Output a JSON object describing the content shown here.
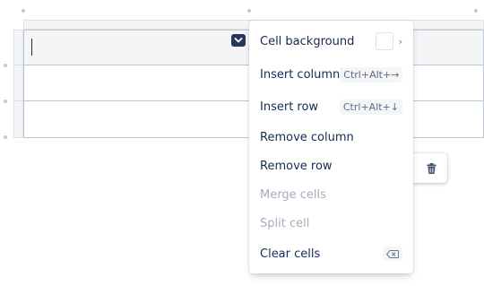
{
  "context_menu": {
    "items": [
      {
        "label": "Cell background",
        "disabled": false
      },
      {
        "label": "Insert column",
        "shortcut": "Ctrl+Alt+→",
        "disabled": false
      },
      {
        "label": "Insert row",
        "shortcut": "Ctrl+Alt+↓",
        "disabled": false
      },
      {
        "label": "Remove column",
        "disabled": false
      },
      {
        "label": "Remove row",
        "disabled": false
      },
      {
        "label": "Merge cells",
        "disabled": true
      },
      {
        "label": "Split cell",
        "disabled": true
      },
      {
        "label": "Clear cells",
        "disabled": false
      }
    ],
    "cell_background_chevron": "›"
  },
  "icons": {
    "cell_menu": "chevron-down-icon",
    "delete": "trash-icon",
    "clear": "backspace-icon",
    "submenu": "chevron-right-icon"
  },
  "colors": {
    "header_cell": "#f4f5f7",
    "grid_line": "#c1c7d0",
    "text": "#172b4d",
    "disabled_text": "#a5adba",
    "cell_menu_button": "#253858"
  }
}
